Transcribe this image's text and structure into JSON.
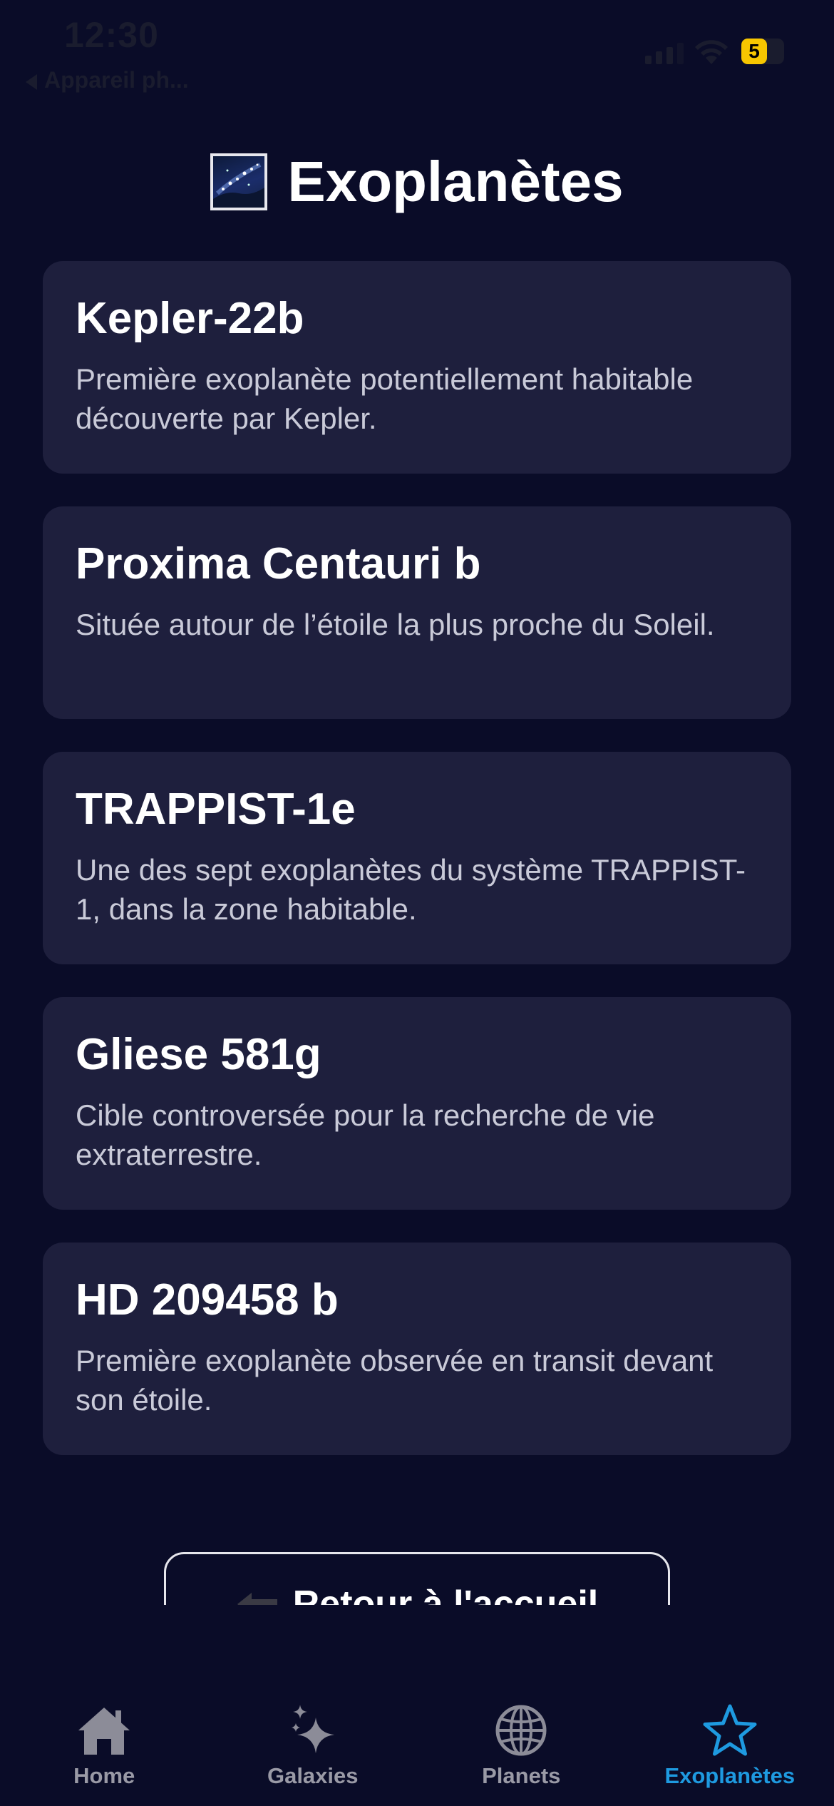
{
  "status_bar": {
    "time": "12:30",
    "back_app": "Appareil ph...",
    "battery_level": "5"
  },
  "header": {
    "title": "Exoplanètes",
    "icon": "milky-way-emoji"
  },
  "exoplanets": [
    {
      "name": "Kepler-22b",
      "description": "Première exoplanète potentiellement habitable découverte par Kepler."
    },
    {
      "name": "Proxima Centauri b",
      "description": "Située autour de l’étoile la plus proche du Soleil."
    },
    {
      "name": "TRAPPIST-1e",
      "description": "Une des sept exoplanètes du système TRAPPIST-1, dans la zone habitable."
    },
    {
      "name": "Gliese 581g",
      "description": "Cible controversée pour la recherche de vie extraterrestre."
    },
    {
      "name": "HD 209458 b",
      "description": "Première exoplanète observée en transit devant son étoile."
    }
  ],
  "return_button": {
    "label": "Retour à l'accueil",
    "icon": "arrow-left-icon"
  },
  "tab_bar": {
    "tabs": [
      {
        "label": "Home",
        "icon": "house-icon",
        "active": false
      },
      {
        "label": "Galaxies",
        "icon": "sparkles-icon",
        "active": false
      },
      {
        "label": "Planets",
        "icon": "globe-icon",
        "active": false
      },
      {
        "label": "Exoplanètes",
        "icon": "star-icon",
        "active": true
      }
    ]
  },
  "colors": {
    "background": "#0a0c28",
    "card": "#1e1f3d",
    "active_tab": "#1e9ae0",
    "inactive_tab": "#9a9aa6",
    "battery": "#f7c600"
  }
}
